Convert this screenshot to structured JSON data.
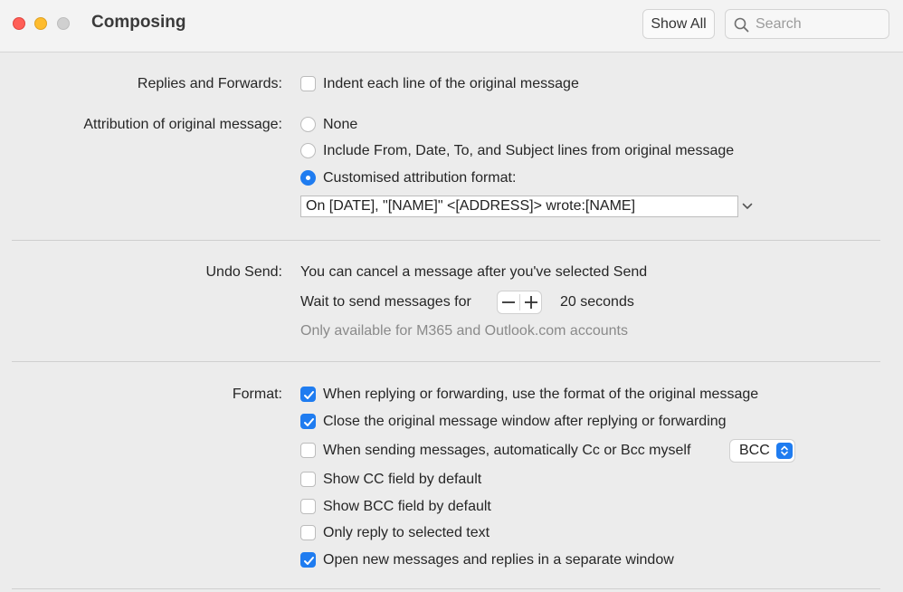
{
  "window": {
    "title": "Composing",
    "show_all": "Show All",
    "search_placeholder": "Search"
  },
  "replies": {
    "label": "Replies and Forwards:",
    "indent_option": "Indent each line of the original message",
    "indent_checked": false
  },
  "attribution": {
    "label": "Attribution of original message:",
    "options": [
      {
        "label": "None",
        "selected": false
      },
      {
        "label": "Include From, Date, To, and Subject lines from original message",
        "selected": false
      },
      {
        "label": "Customised attribution format:",
        "selected": true
      }
    ],
    "format_value": "On [DATE], \"[NAME]\" <[ADDRESS]> wrote:[NAME]"
  },
  "undo_send": {
    "label": "Undo Send:",
    "description": "You can cancel a message after you've selected Send",
    "wait_label": "Wait to send messages for",
    "wait_value": "20 seconds",
    "note": "Only available for M365 and Outlook.com accounts"
  },
  "format": {
    "label": "Format:",
    "options": [
      {
        "label": "When replying or forwarding, use the format of the original message",
        "checked": true
      },
      {
        "label": "Close the original message window after replying or forwarding",
        "checked": true
      },
      {
        "label": "When sending messages, automatically Cc or Bcc myself",
        "checked": false
      },
      {
        "label": "Show CC field by default",
        "checked": false
      },
      {
        "label": "Show BCC field by default",
        "checked": false
      },
      {
        "label": "Only reply to selected text",
        "checked": false
      },
      {
        "label": "Open new messages and replies in a separate window",
        "checked": true
      }
    ],
    "cc_bcc_select": "BCC"
  },
  "colors": {
    "accent": "#1f7cf0",
    "close": "#ff5f57",
    "minimize": "#febc2e",
    "zoom_disabled": "#d0d0d0"
  }
}
